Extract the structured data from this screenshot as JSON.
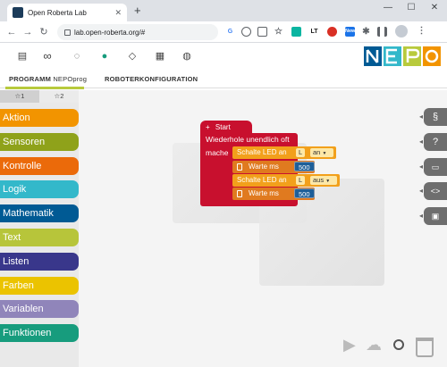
{
  "browser": {
    "tab_title": "Open Roberta Lab",
    "tab_close": "✕",
    "new_tab": "+",
    "url": "lab.open-roberta.org/#",
    "window_controls": {
      "minimize": "—",
      "maximize": "☐",
      "close": "✕"
    },
    "nav": {
      "back": "←",
      "forward": "→",
      "reload": "↻"
    },
    "ext_labels": [
      "G",
      "LT",
      "New"
    ]
  },
  "app": {
    "logo_text": "NEPO",
    "toolbar_icons": [
      "notebook-icon",
      "infinity-icon",
      "lightbulb-icon",
      "person-icon",
      "graduation-cap-icon",
      "grid-icon",
      "globe-icon"
    ],
    "tabs": {
      "program_prefix": "PROGRAMM",
      "program_name": "NEPOprog",
      "robot_config": "ROBOTERKONFIGURATION"
    }
  },
  "toolbox": {
    "level_tabs": [
      "☆1",
      "☆2"
    ],
    "categories": [
      {
        "label": "Aktion",
        "color": "#f29400"
      },
      {
        "label": "Sensoren",
        "color": "#8fa21a"
      },
      {
        "label": "Kontrolle",
        "color": "#eb6a0a"
      },
      {
        "label": "Logik",
        "color": "#33b8ca"
      },
      {
        "label": "Mathematik",
        "color": "#005a94"
      },
      {
        "label": "Text",
        "color": "#b7c53a"
      },
      {
        "label": "Listen",
        "color": "#39378b"
      },
      {
        "label": "Farben",
        "color": "#ebc300"
      },
      {
        "label": "Variablen",
        "color": "#9085ba"
      },
      {
        "label": "Funktionen",
        "color": "#179c7d"
      }
    ]
  },
  "program": {
    "start_label": "Start",
    "start_icon": "+",
    "loop_label": "Wiederhole unendlich oft",
    "do_label": "mache",
    "statements": [
      {
        "type": "led",
        "label": "Schalte LED an",
        "port": "L",
        "value": "an"
      },
      {
        "type": "wait",
        "label": "Warte ms",
        "value": "500"
      },
      {
        "type": "led",
        "label": "Schalte LED an",
        "port": "L",
        "value": "aus"
      },
      {
        "type": "wait",
        "label": "Warte ms",
        "value": "500"
      }
    ]
  },
  "right_tabs": [
    "§",
    "?",
    "▭",
    "<>",
    "▣"
  ],
  "bottom_tools": [
    "run-icon",
    "cloud-upload-icon",
    "zoom-icon",
    "trash-icon"
  ]
}
